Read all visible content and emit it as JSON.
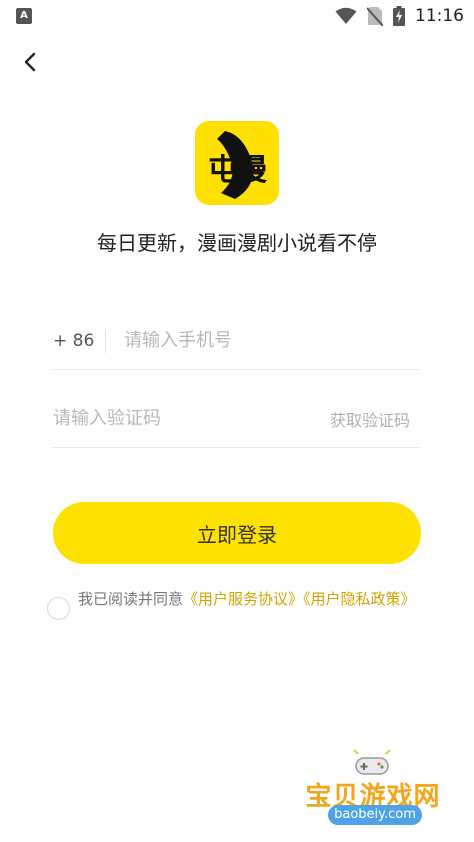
{
  "status_bar": {
    "app_icon_letter": "A",
    "time": "11:16",
    "icons": [
      "wifi-icon",
      "no-sim-icon",
      "battery-charging-icon"
    ]
  },
  "header": {
    "back_icon": "chevron-left-icon"
  },
  "logo": {
    "text": "屯漫",
    "color": "#ffe000"
  },
  "tagline": "每日更新，漫画漫剧小说看不停",
  "phone": {
    "country_code": "+ 86",
    "placeholder": "请输入手机号",
    "value": ""
  },
  "code": {
    "placeholder": "请输入验证码",
    "value": "",
    "get_code_label": "获取验证码"
  },
  "login_button": {
    "label": "立即登录",
    "color": "#ffe100"
  },
  "agreement": {
    "prefix": "我已阅读并同意",
    "user_agreement": "《用户服务协议》",
    "privacy_policy": "《用户隐私政策》",
    "checked": false
  },
  "watermark": {
    "title": "宝贝游戏网",
    "url": "baobeiy.com"
  }
}
